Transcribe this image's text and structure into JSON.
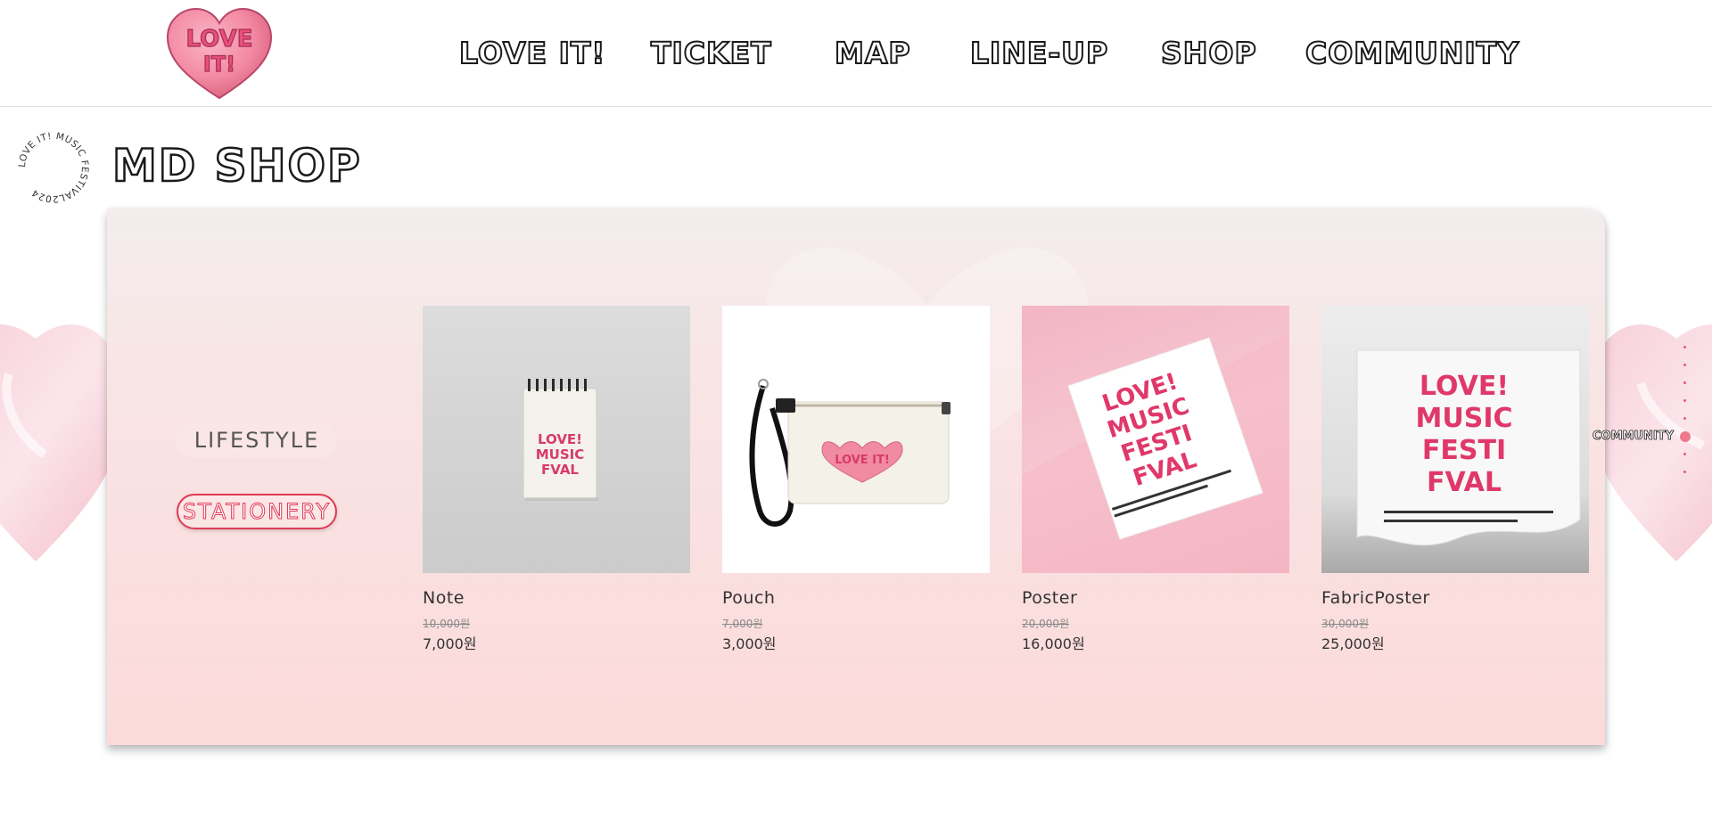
{
  "brand": {
    "logo_text_line1": "LOVE",
    "logo_text_line2": "IT!",
    "logo_color": "#f07c96"
  },
  "nav": {
    "items": [
      {
        "label": "LOVE IT!"
      },
      {
        "label": "TICKET"
      },
      {
        "label": "MAP"
      },
      {
        "label": "LINE-UP"
      },
      {
        "label": "SHOP"
      },
      {
        "label": "COMMUNITY"
      }
    ]
  },
  "badge": {
    "circular_text": "LOVE IT! MUSIC FESTIVAL2024"
  },
  "page": {
    "title": "MD SHOP"
  },
  "categories": [
    {
      "label": "LIFESTYLE",
      "active": false
    },
    {
      "label": "STATIONERY",
      "active": true
    }
  ],
  "products": [
    {
      "name": "Note",
      "original_price": "10,000원",
      "price": "7,000원",
      "icon": "notebook-image",
      "cover_line1": "LOVE!",
      "cover_line2": "MUSIC",
      "cover_line3": "FVAL"
    },
    {
      "name": "Pouch",
      "original_price": "7,000원",
      "price": "3,000원",
      "icon": "pouch-image",
      "patch_text": "LOVE IT!"
    },
    {
      "name": "Poster",
      "original_price": "20,000원",
      "price": "16,000원",
      "icon": "poster-image",
      "poster_line1": "LOVE!",
      "poster_line2": "MUSIC",
      "poster_line3": "FESTI",
      "poster_line4": "FVAL"
    },
    {
      "name": "FabricPoster",
      "original_price": "30,000원",
      "price": "25,000원",
      "icon": "fabric-poster-image",
      "poster_line1": "LOVE!",
      "poster_line2": "MUSIC",
      "poster_line3": "FESTI",
      "poster_line4": "FVAL"
    }
  ],
  "pager": {
    "label": "COMMUNITY",
    "dot_count": 8,
    "active_index": 5
  },
  "colors": {
    "accent": "#e03a54",
    "pink_light": "#fcdada",
    "pink_heart": "#f07c96"
  }
}
